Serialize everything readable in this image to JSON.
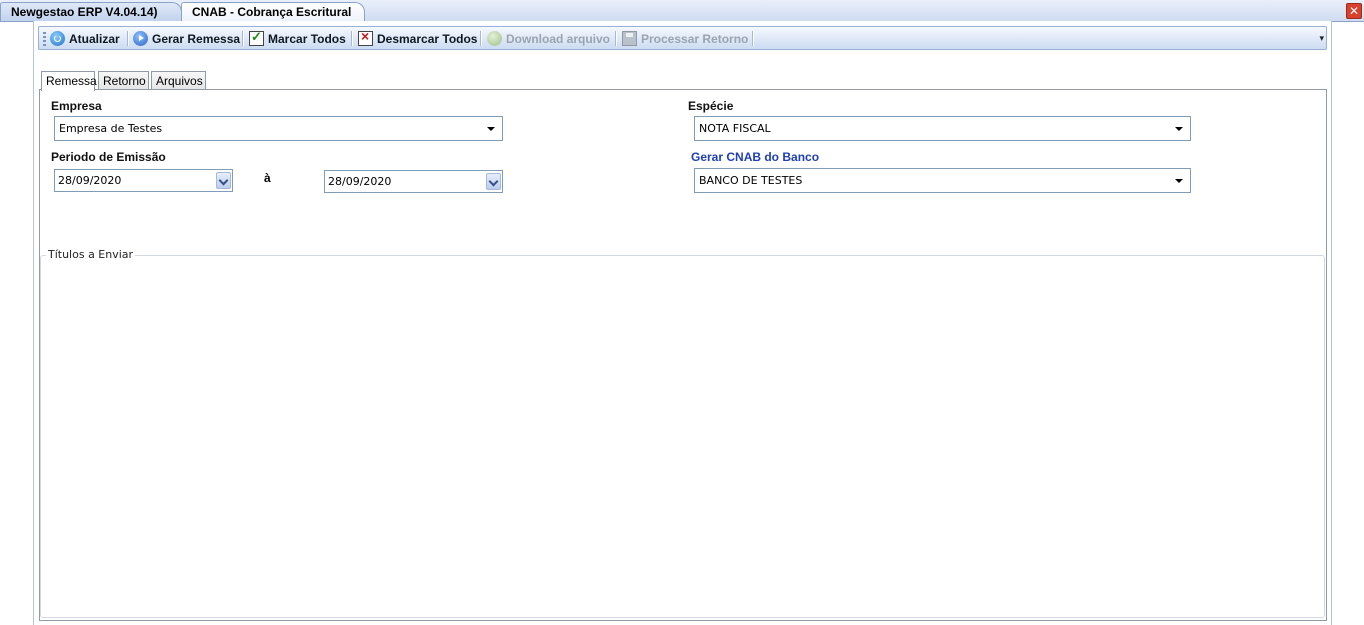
{
  "window": {
    "tabs": [
      {
        "label": "Newgestao ERP V4.04.14)"
      },
      {
        "label": "CNAB - Cobrança Escritural"
      }
    ]
  },
  "toolbar": {
    "atualizar": "Atualizar",
    "gerar_remessa": "Gerar Remessa",
    "marcar_todos": "Marcar Todos",
    "desmarcar_todos": "Desmarcar Todos",
    "download_arquivo": "Download arquivo",
    "processar_retorno": "Processar Retorno"
  },
  "tabs": [
    {
      "label": "Remessa"
    },
    {
      "label": "Retorno"
    },
    {
      "label": "Arquivos"
    }
  ],
  "form": {
    "empresa_label": "Empresa",
    "empresa_value": "Empresa de Testes",
    "periodo_label": "Periodo de Emissão",
    "date_from": "28/09/2020",
    "date_sep": "à",
    "date_to": "28/09/2020",
    "especie_label": "Espécie",
    "especie_value": "NOTA FISCAL",
    "banco_label": "Gerar CNAB do Banco",
    "banco_value": "BANCO DE TESTES"
  },
  "titulos": {
    "title": "Títulos a Enviar"
  },
  "colors": {
    "accent_blue": "#1f3fb5",
    "close_red": "#d9412c"
  }
}
